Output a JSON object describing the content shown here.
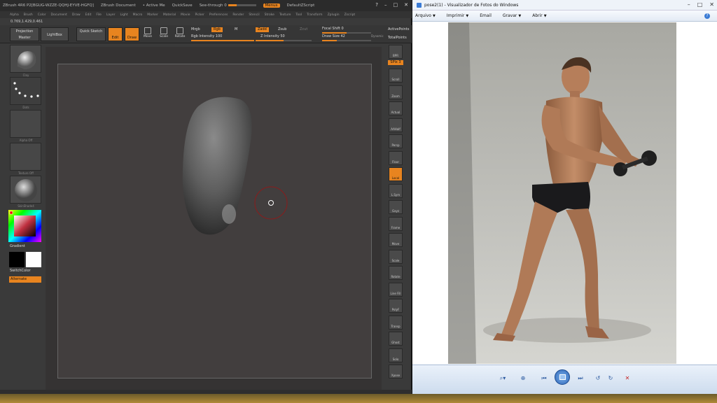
{
  "zbrush": {
    "title_bar": {
      "app_title": "ZBrush 4R6 P2[BGUG-WZZE-QQHJ-EYVE-HGFQ]",
      "document": "ZBrush Document",
      "active_mem": "• Active Me",
      "quicksave": "QuickSave",
      "see_through": "See-through 0",
      "menus": "Menus",
      "default_script": "DefaultZScript"
    },
    "menu_items": [
      "Alpha",
      "Brush",
      "Color",
      "Document",
      "Draw",
      "Edit",
      "File",
      "Layer",
      "Light",
      "Macro",
      "Marker",
      "Material",
      "Movie",
      "Picker",
      "Preferences",
      "Render",
      "Stencil",
      "Stroke",
      "Texture",
      "Tool",
      "Transform",
      "Zplugin",
      "Zscript"
    ],
    "coords": "0.769,1.429,0.461",
    "top_shelf": {
      "projection_master": "Projection Master",
      "lightbox": "LightBox",
      "quick_sketch": "Quick Sketch",
      "edit": "Edit",
      "draw": "Draw",
      "move": "Move",
      "scale": "Scale",
      "rotate": "Rotate",
      "mrgb": "Mrgb",
      "rgb": "Rgb",
      "m": "M",
      "zadd": "Zadd",
      "zsub": "Zsub",
      "zcut": "Zcut",
      "rgb_intensity": "Rgb Intensity 100",
      "z_intensity": "Z Intensity 50",
      "focal_shift": "Focal Shift 0",
      "draw_size": "Draw Size 42",
      "dynamic": "Dynamic",
      "active_points": "ActivePoints",
      "total_points": "TotalPoints"
    },
    "left_shelf": {
      "brush_label": "Clay",
      "stroke_label": "Dots",
      "alpha_label": "Alpha Off",
      "texture_label": "Texture Off",
      "material_label": "SkinShade4",
      "gradient": "Gradient",
      "switch_color": "SwitchColor",
      "alternate": "Alternate"
    },
    "right_shelf": {
      "spix": "SPix 3",
      "items": [
        "BPR",
        "Scroll",
        "Zoom",
        "Actual",
        "AAHalf",
        "Persp",
        "Floor",
        "Local",
        "L.Sym",
        "Gxyz",
        "Frame",
        "Move",
        "Scale",
        "Rotate",
        "Line Fill",
        "PolyF",
        "Transp",
        "Ghost",
        "Solo",
        "Xpose"
      ]
    },
    "colors": {
      "accent": "#e8841f",
      "panel": "#3a3a3a",
      "canvas": "#423e3e"
    }
  },
  "photo_viewer": {
    "title": "pose2(1) - Visualizador de Fotos do Windows",
    "menu": {
      "file": "Arquivo",
      "print": "Imprimir",
      "email": "Email",
      "burn": "Gravar",
      "open": "Abrir"
    },
    "controls": {
      "zoom": "zoom-icon",
      "fit": "fit-window-icon",
      "prev": "previous-icon",
      "slideshow": "slideshow-icon",
      "next": "next-icon",
      "rotate_ccw": "rotate-ccw-icon",
      "rotate_cw": "rotate-cw-icon",
      "delete": "delete-icon"
    }
  }
}
